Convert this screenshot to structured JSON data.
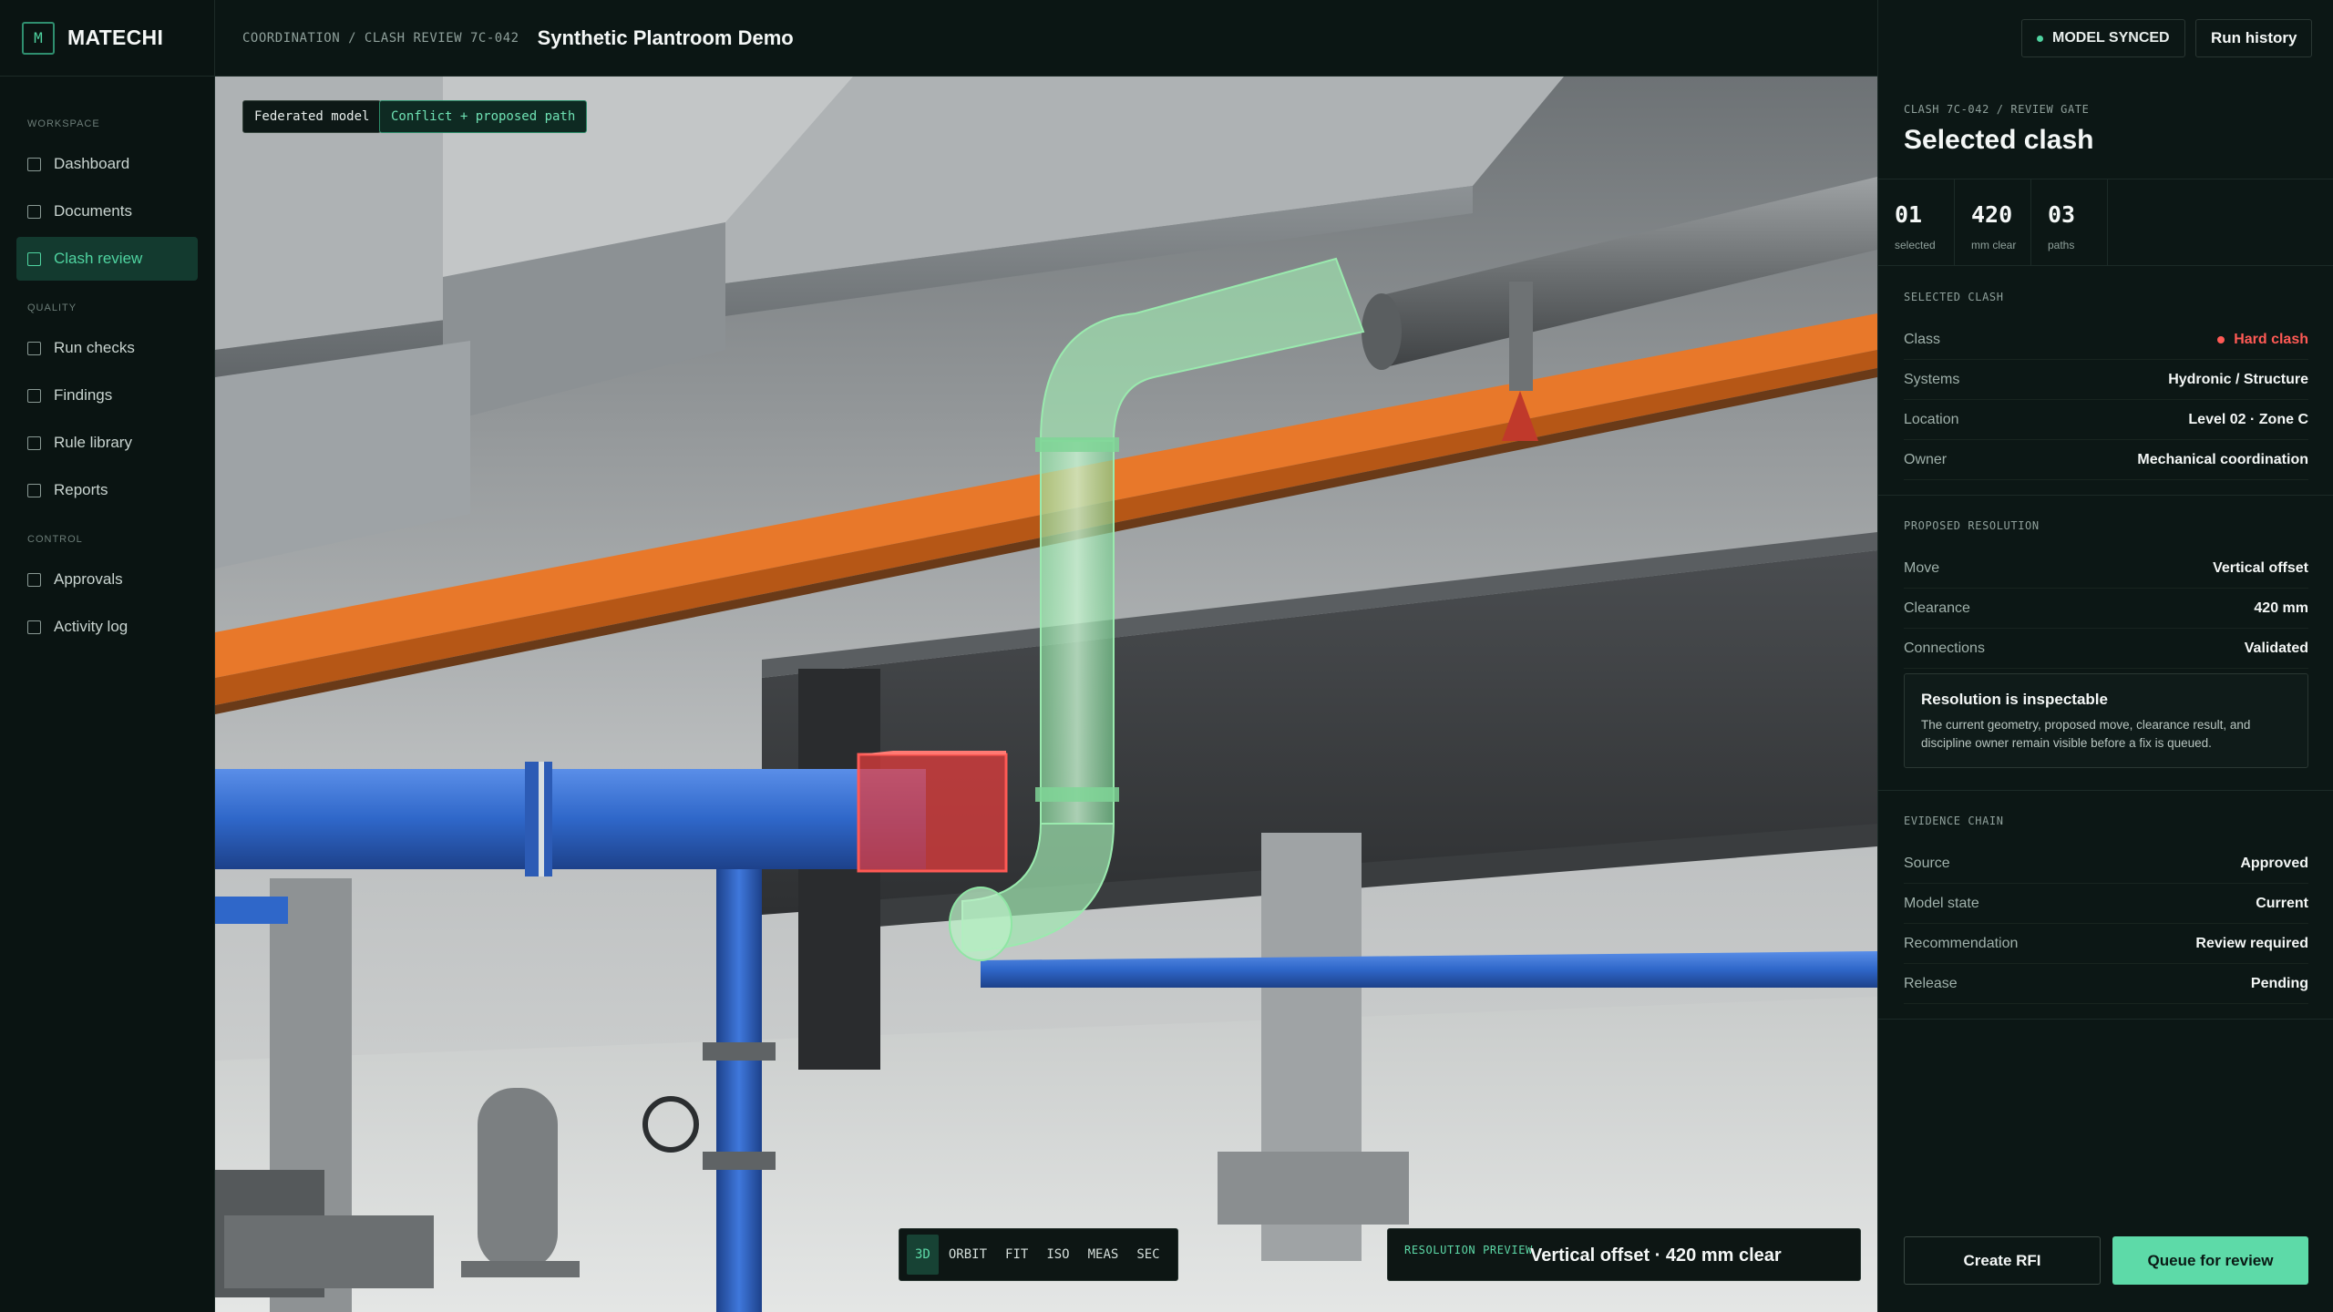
{
  "app": {
    "brand_mark": "M",
    "brand_name": "MATECHI"
  },
  "sidebar": {
    "sections": [
      {
        "label": "WORKSPACE",
        "items": [
          {
            "label": "Dashboard"
          },
          {
            "label": "Documents"
          },
          {
            "label": "Clash review",
            "active": true
          }
        ]
      },
      {
        "label": "QUALITY",
        "items": [
          {
            "label": "Run checks"
          },
          {
            "label": "Findings"
          },
          {
            "label": "Rule library"
          },
          {
            "label": "Reports"
          }
        ]
      },
      {
        "label": "CONTROL",
        "items": [
          {
            "label": "Approvals"
          },
          {
            "label": "Activity log"
          }
        ]
      }
    ]
  },
  "header": {
    "breadcrumb": "COORDINATION / CLASH REVIEW 7C-042",
    "title": "Synthetic Plantroom Demo",
    "status": "MODEL SYNCED",
    "run_history": "Run history"
  },
  "viewport": {
    "tag_federated": "Federated model",
    "tag_conflict": "Conflict + proposed path",
    "tools": [
      "3D",
      "ORBIT",
      "FIT",
      "ISO",
      "MEAS",
      "SEC"
    ],
    "active_tool": "3D",
    "preview_label": "RESOLUTION PREVIEW",
    "preview_value": "Vertical offset · 420 mm clear"
  },
  "panel": {
    "eyebrow": "CLASH 7C-042 / REVIEW GATE",
    "title": "Selected clash",
    "stats": [
      {
        "value": "01",
        "label": "selected"
      },
      {
        "value": "420",
        "label": "mm clear"
      },
      {
        "value": "03",
        "label": "paths"
      }
    ],
    "selected": {
      "label": "SELECTED CLASH",
      "rows": [
        {
          "k": "Class",
          "v": "Hard clash",
          "danger": true
        },
        {
          "k": "Systems",
          "v": "Hydronic / Structure"
        },
        {
          "k": "Location",
          "v": "Level 02 · Zone C"
        },
        {
          "k": "Owner",
          "v": "Mechanical coordination"
        }
      ]
    },
    "resolution": {
      "label": "PROPOSED RESOLUTION",
      "rows": [
        {
          "k": "Move",
          "v": "Vertical offset"
        },
        {
          "k": "Clearance",
          "v": "420 mm"
        },
        {
          "k": "Connections",
          "v": "Validated"
        }
      ]
    },
    "note": {
      "title": "Resolution is inspectable",
      "body": "The current geometry, proposed move, clearance result, and discipline owner remain visible before a fix is queued."
    },
    "evidence": {
      "label": "EVIDENCE CHAIN",
      "rows": [
        {
          "k": "Source",
          "v": "Approved"
        },
        {
          "k": "Model state",
          "v": "Current"
        },
        {
          "k": "Recommendation",
          "v": "Review required"
        },
        {
          "k": "Release",
          "v": "Pending"
        }
      ]
    },
    "btn_rfi": "Create RFI",
    "btn_queue": "Queue for review"
  },
  "colors": {
    "accent": "#5ddaa8",
    "danger": "#ff5a55",
    "tray": "#e8782a",
    "pipe_blue": "#2f67c9",
    "proposed_green": "#8fe6a4"
  }
}
